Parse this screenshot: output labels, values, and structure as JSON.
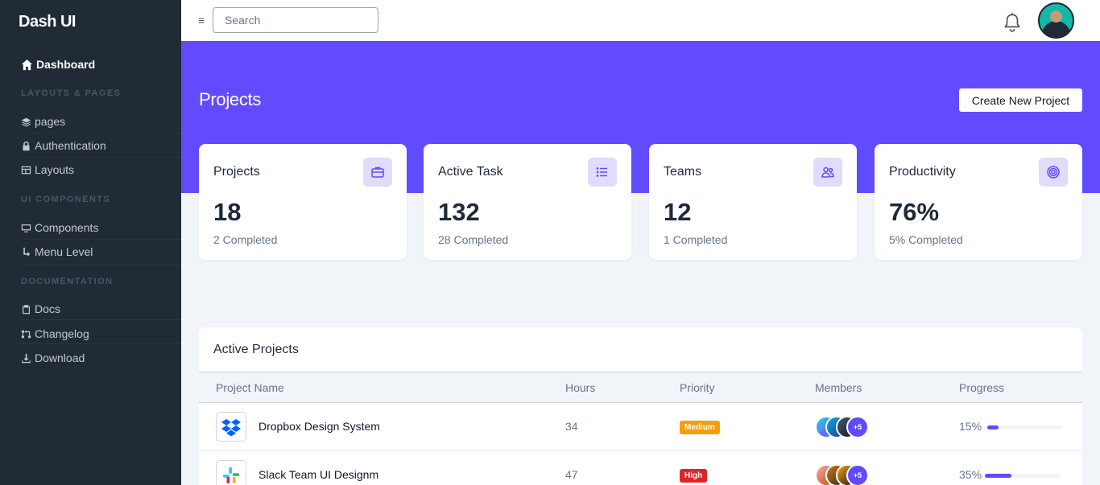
{
  "sidebar": {
    "brand": "Dash UI",
    "dashboard": "Dashboard",
    "sections": [
      {
        "heading": "LAYOUTS & PAGES",
        "items": [
          "pages",
          "Authentication",
          "Layouts"
        ]
      },
      {
        "heading": "UI COMPONENTS",
        "items": [
          "Components",
          "Menu Level"
        ]
      },
      {
        "heading": "DOCUMENTATION",
        "items": [
          "Docs",
          "Changelog",
          "Download"
        ]
      }
    ]
  },
  "topbar": {
    "menu_icon": "≡",
    "search_placeholder": "Search",
    "bell_icon": "bell-icon",
    "avatar_icon": "user-avatar"
  },
  "header": {
    "title": "Projects",
    "create_button": "Create New Project"
  },
  "stats": [
    {
      "title": "Projects",
      "value": "18",
      "sub": "2 Completed",
      "icon": "briefcase-icon"
    },
    {
      "title": "Active Task",
      "value": "132",
      "sub": "28 Completed",
      "icon": "list-icon"
    },
    {
      "title": "Teams",
      "value": "12",
      "sub": "1 Completed",
      "icon": "people-icon"
    },
    {
      "title": "Productivity",
      "value": "76%",
      "sub": "5% Completed",
      "icon": "target-icon"
    }
  ],
  "active_projects": {
    "title": "Active Projects",
    "columns": [
      "Project Name",
      "Hours",
      "Priority",
      "Members",
      "Progress"
    ],
    "rows": [
      {
        "name": "Dropbox Design System",
        "hours": "34",
        "priority": "Medium",
        "priority_color": "#f59e0b",
        "members_more": "+5",
        "progress_label": "15%",
        "progress": 0.15,
        "logo": "dropbox-logo"
      },
      {
        "name": "Slack Team UI Designm",
        "hours": "47",
        "priority": "High",
        "priority_color": "#dc2626",
        "members_more": "+5",
        "progress_label": "35%",
        "progress": 0.35,
        "logo": "slack-logo"
      }
    ]
  },
  "colors": {
    "accent": "#624bff",
    "sidebar": "#212b36"
  }
}
